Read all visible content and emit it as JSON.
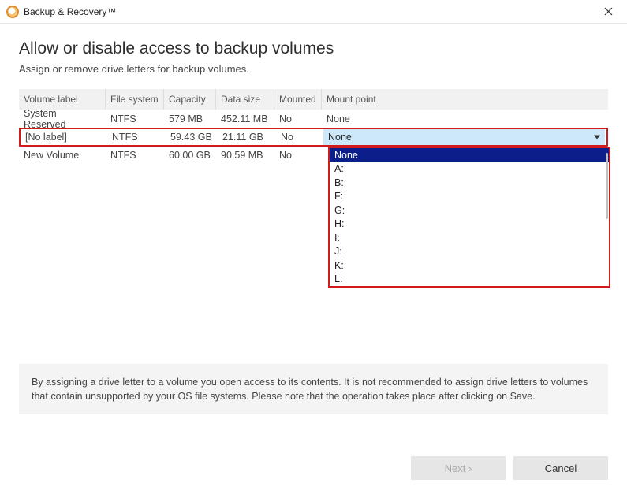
{
  "titlebar": {
    "app_title": "Backup & Recovery™"
  },
  "page": {
    "heading": "Allow or disable access to backup volumes",
    "subtitle": "Assign or remove drive letters for backup volumes."
  },
  "columns": {
    "volume_label": "Volume label",
    "file_system": "File system",
    "capacity": "Capacity",
    "data_size": "Data size",
    "mounted": "Mounted",
    "mount_point": "Mount point"
  },
  "rows": [
    {
      "volume": "System Reserved",
      "fs": "NTFS",
      "capacity": "579 MB",
      "data_size": "452.11 MB",
      "mounted": "No",
      "mount_point": "None"
    },
    {
      "volume": "[No label]",
      "fs": "NTFS",
      "capacity": "59.43 GB",
      "data_size": "21.11 GB",
      "mounted": "No",
      "mount_point": "None"
    },
    {
      "volume": "New Volume",
      "fs": "NTFS",
      "capacity": "60.00 GB",
      "data_size": "90.59 MB",
      "mounted": "No",
      "mount_point": ""
    }
  ],
  "dropdown": {
    "options": [
      "None",
      "A:",
      "B:",
      "F:",
      "G:",
      "H:",
      "I:",
      "J:",
      "K:",
      "L:"
    ],
    "selected": "None"
  },
  "info_text": "By assigning a drive letter to a volume you open access to its contents. It is not recommended to assign drive letters to volumes that contain unsupported by your OS file systems. Please note that the operation takes place after clicking on Save.",
  "buttons": {
    "next": "Next ›",
    "cancel": "Cancel"
  }
}
